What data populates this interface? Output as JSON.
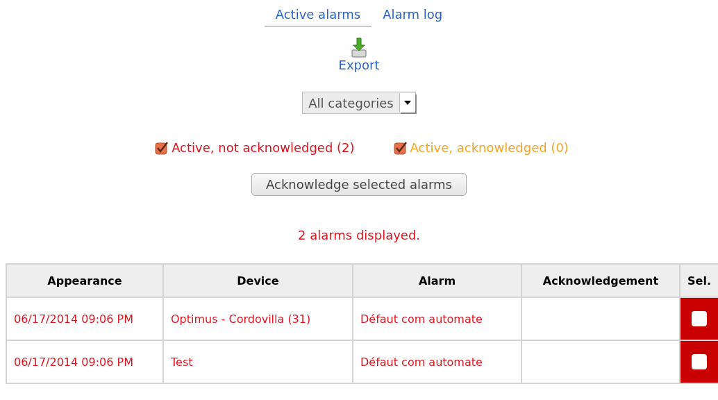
{
  "tabs": [
    {
      "label": "Active alarms",
      "selected": true
    },
    {
      "label": "Alarm log",
      "selected": false
    }
  ],
  "export": {
    "label": "Export"
  },
  "category_select": {
    "value": "All categories"
  },
  "filters": [
    {
      "label": "Active, not acknowledged (2)",
      "checked": true,
      "color": "#e0141e"
    },
    {
      "label": "Active, acknowledged (0)",
      "checked": true,
      "color": "#f5a623"
    }
  ],
  "acknowledge_button": {
    "label": "Acknowledge selected alarms"
  },
  "message": "2 alarms displayed.",
  "table": {
    "columns": [
      "Appearance",
      "Device",
      "Alarm",
      "Acknowledgement",
      "Sel."
    ],
    "rows": [
      {
        "appearance": "06/17/2014 09:06 PM",
        "device": "Optimus - Cordovilla (31)",
        "alarm": "Défaut com automate",
        "acknowledgement": "",
        "selected": false
      },
      {
        "appearance": "06/17/2014 09:06 PM",
        "device": "Test",
        "alarm": "Défaut com automate",
        "acknowledgement": "",
        "selected": false
      }
    ]
  }
}
